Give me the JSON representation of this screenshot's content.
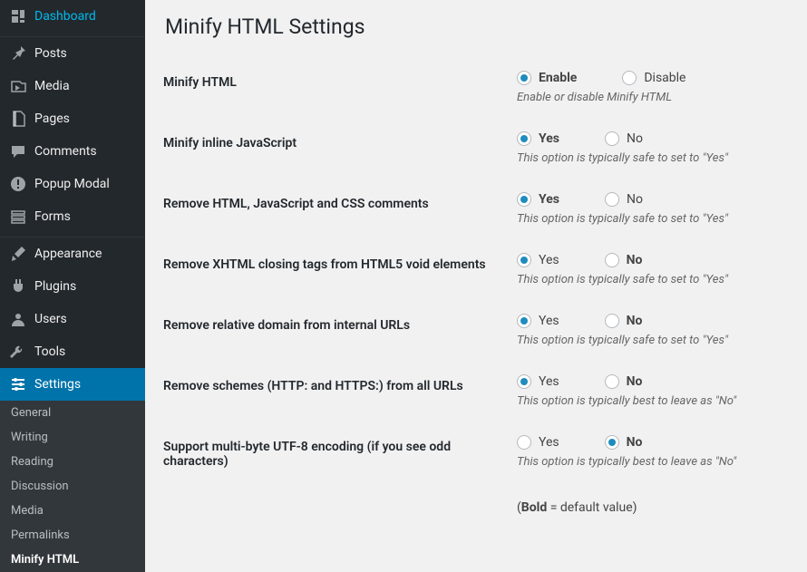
{
  "sidebar": {
    "items": [
      {
        "id": "dashboard",
        "label": "Dashboard",
        "icon": "dashboard"
      },
      {
        "id": "posts",
        "label": "Posts",
        "icon": "pin"
      },
      {
        "id": "media",
        "label": "Media",
        "icon": "media"
      },
      {
        "id": "pages",
        "label": "Pages",
        "icon": "pages"
      },
      {
        "id": "comments",
        "label": "Comments",
        "icon": "comment"
      },
      {
        "id": "popup-modal",
        "label": "Popup Modal",
        "icon": "exclaim"
      },
      {
        "id": "forms",
        "label": "Forms",
        "icon": "form"
      },
      {
        "id": "appearance",
        "label": "Appearance",
        "icon": "brush"
      },
      {
        "id": "plugins",
        "label": "Plugins",
        "icon": "plugin"
      },
      {
        "id": "users",
        "label": "Users",
        "icon": "user"
      },
      {
        "id": "tools",
        "label": "Tools",
        "icon": "wrench"
      },
      {
        "id": "settings",
        "label": "Settings",
        "icon": "sliders",
        "active": true
      }
    ],
    "subItems": [
      {
        "id": "general",
        "label": "General"
      },
      {
        "id": "writing",
        "label": "Writing"
      },
      {
        "id": "reading",
        "label": "Reading"
      },
      {
        "id": "discussion",
        "label": "Discussion"
      },
      {
        "id": "media-settings",
        "label": "Media"
      },
      {
        "id": "permalinks",
        "label": "Permalinks"
      },
      {
        "id": "minify-html",
        "label": "Minify HTML",
        "current": true
      }
    ]
  },
  "page": {
    "title": "Minify HTML Settings",
    "rows": [
      {
        "id": "minify-html",
        "label": "Minify HTML",
        "opt1": "Enable",
        "opt1_bold": true,
        "opt2": "Disable",
        "opt2_bold": false,
        "selected": 1,
        "desc": "Enable or disable Minify HTML"
      },
      {
        "id": "minify-js",
        "label": "Minify inline JavaScript",
        "opt1": "Yes",
        "opt1_bold": true,
        "opt2": "No",
        "opt2_bold": false,
        "selected": 1,
        "desc": "This option is typically safe to set to \"Yes\""
      },
      {
        "id": "remove-comments",
        "label": "Remove HTML, JavaScript and CSS comments",
        "opt1": "Yes",
        "opt1_bold": true,
        "opt2": "No",
        "opt2_bold": false,
        "selected": 1,
        "desc": "This option is typically safe to set to \"Yes\""
      },
      {
        "id": "remove-xhtml",
        "label": "Remove XHTML closing tags from HTML5 void elements",
        "opt1": "Yes",
        "opt1_bold": false,
        "opt2": "No",
        "opt2_bold": true,
        "selected": 1,
        "desc": "This option is typically safe to set to \"Yes\""
      },
      {
        "id": "remove-relative",
        "label": "Remove relative domain from internal URLs",
        "opt1": "Yes",
        "opt1_bold": false,
        "opt2": "No",
        "opt2_bold": true,
        "selected": 1,
        "desc": "This option is typically safe to set to \"Yes\""
      },
      {
        "id": "remove-schemes",
        "label": "Remove schemes (HTTP: and HTTPS:) from all URLs",
        "opt1": "Yes",
        "opt1_bold": false,
        "opt2": "No",
        "opt2_bold": true,
        "selected": 1,
        "desc": "This option is typically best to leave as \"No\""
      },
      {
        "id": "utf8",
        "label": "Support multi-byte UTF-8 encoding (if you see odd characters)",
        "opt1": "Yes",
        "opt1_bold": false,
        "opt2": "No",
        "opt2_bold": true,
        "selected": 2,
        "desc": "This option is typically best to leave as \"No\""
      }
    ],
    "note_bold": "Bold",
    "note_rest": " = default value)"
  }
}
